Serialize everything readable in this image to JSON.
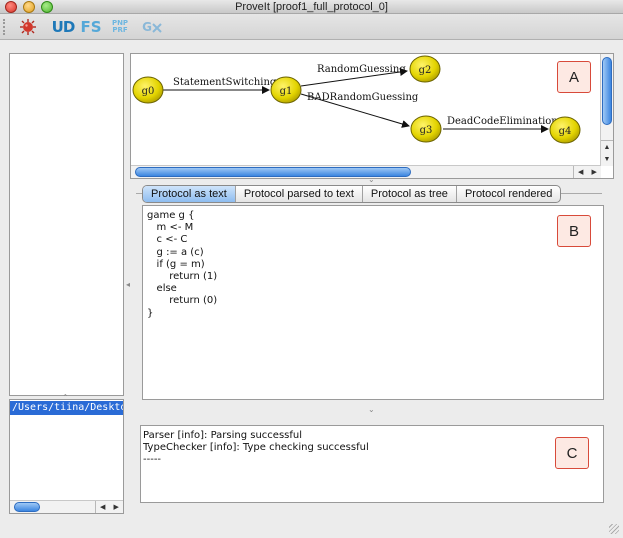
{
  "window": {
    "title": "ProveIt [proof1_full_protocol_0]"
  },
  "toolbar": {
    "buttons": [
      {
        "name": "virus-icon",
        "label": ""
      },
      {
        "name": "ud-button",
        "label": "UD"
      },
      {
        "name": "fs-button",
        "label": "FS"
      },
      {
        "name": "pnp-prf-button",
        "label_top": "PNP",
        "label_bottom": "PRF"
      },
      {
        "name": "gx-button",
        "label": "G"
      }
    ]
  },
  "file_list": {
    "selected_path": "/Users/tiina/Desktop/Th"
  },
  "graph": {
    "nodes": [
      "g0",
      "g1",
      "g2",
      "g3",
      "g4"
    ],
    "edges": [
      {
        "from": "g0",
        "to": "g1",
        "label": "StatementSwitching"
      },
      {
        "from": "g1",
        "to": "g2",
        "label": "RandomGuessing"
      },
      {
        "from": "g1",
        "to": "g3",
        "label": "BADRandomGuessing"
      },
      {
        "from": "g3",
        "to": "g4",
        "label": "DeadCodeElimination"
      }
    ],
    "node_color": "#e3d400"
  },
  "markers": {
    "a": "A",
    "b": "B",
    "c": "C"
  },
  "tabs": [
    {
      "label": "Protocol as text",
      "active": true
    },
    {
      "label": "Protocol parsed to text",
      "active": false
    },
    {
      "label": "Protocol as tree",
      "active": false
    },
    {
      "label": "Protocol rendered",
      "active": false
    }
  ],
  "protocol_text": [
    "game g {",
    "   m <- M",
    "   c <- C",
    "   g := a (c)",
    "   if (g = m)",
    "       return (1)",
    "   else",
    "       return (0)",
    "}"
  ],
  "console": {
    "lines": [
      "Parser [info]: Parsing successful",
      "TypeChecker [info]: Type checking successful",
      "-----"
    ]
  },
  "colors": {
    "accent_blue": "#3c86e0",
    "marker_border": "#d84a3a",
    "marker_fill": "#fde9e3",
    "selection": "#2a6bd6"
  }
}
